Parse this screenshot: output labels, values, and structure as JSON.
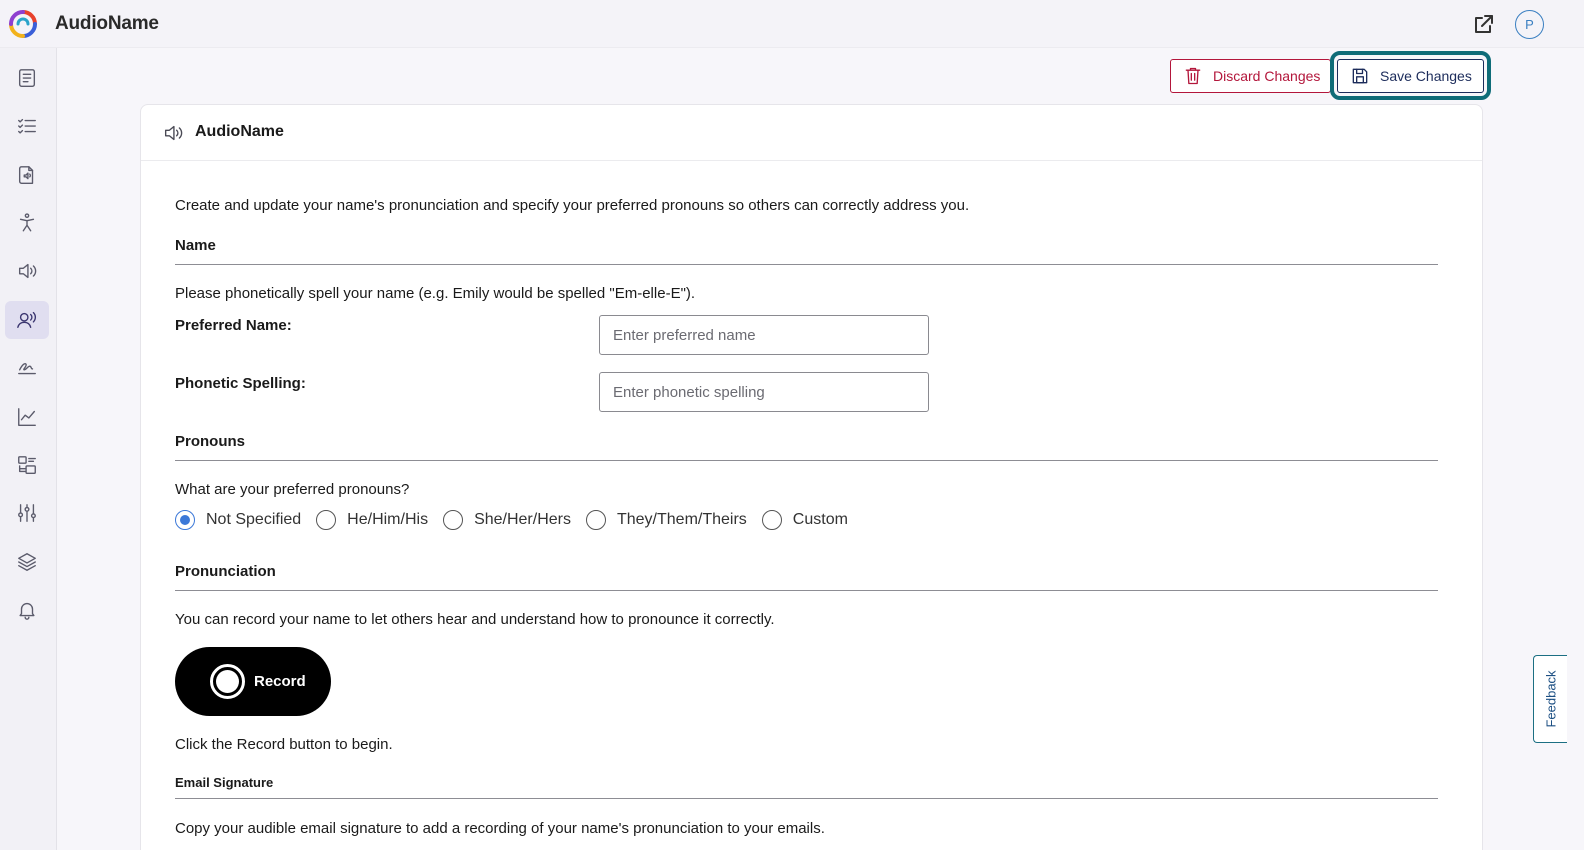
{
  "app": {
    "title": "AudioName",
    "avatar_initial": "P"
  },
  "sidebar": {
    "items": [
      {
        "icon": "document-icon"
      },
      {
        "icon": "checklist-icon"
      },
      {
        "icon": "audio-file-icon"
      },
      {
        "icon": "accessibility-icon"
      },
      {
        "icon": "speaker-icon"
      },
      {
        "icon": "speaking-person-icon",
        "active": true
      },
      {
        "icon": "signature-icon"
      },
      {
        "icon": "analytics-chart-icon"
      },
      {
        "icon": "settings-list-icon"
      },
      {
        "icon": "sliders-icon"
      },
      {
        "icon": "layers-icon"
      },
      {
        "icon": "bell-icon"
      }
    ]
  },
  "toolbar": {
    "discard_label": "Discard Changes",
    "save_label": "Save Changes"
  },
  "card": {
    "title": "AudioName",
    "intro": "Create and update your name's pronunciation and specify your preferred pronouns so others can correctly address you.",
    "name_section": {
      "title": "Name",
      "instructions": "Please phonetically spell your name (e.g. Emily would be spelled \"Em-elle-E\").",
      "preferred_label": "Preferred Name:",
      "preferred_placeholder": "Enter preferred name",
      "phonetic_label": "Phonetic Spelling:",
      "phonetic_placeholder": "Enter phonetic spelling"
    },
    "pronouns_section": {
      "title": "Pronouns",
      "question": "What are your preferred pronouns?",
      "options": [
        "Not Specified",
        "He/Him/His",
        "She/Her/Hers",
        "They/Them/Theirs",
        "Custom"
      ],
      "selected": "Not Specified"
    },
    "pronunciation_section": {
      "title": "Pronunciation",
      "description": "You can record your name to let others hear and understand how to pronounce it correctly.",
      "record_label": "Record",
      "hint": "Click the Record button to begin."
    },
    "email_section": {
      "title": "Email Signature",
      "description": "Copy your audible email signature to add a recording of your name's pronunciation to your emails."
    }
  },
  "feedback_label": "Feedback",
  "colors": {
    "discard": "#b3163b",
    "save": "#1c2c5b",
    "focus_ring": "#0f6c78",
    "radio_selected": "#3b78d8"
  }
}
